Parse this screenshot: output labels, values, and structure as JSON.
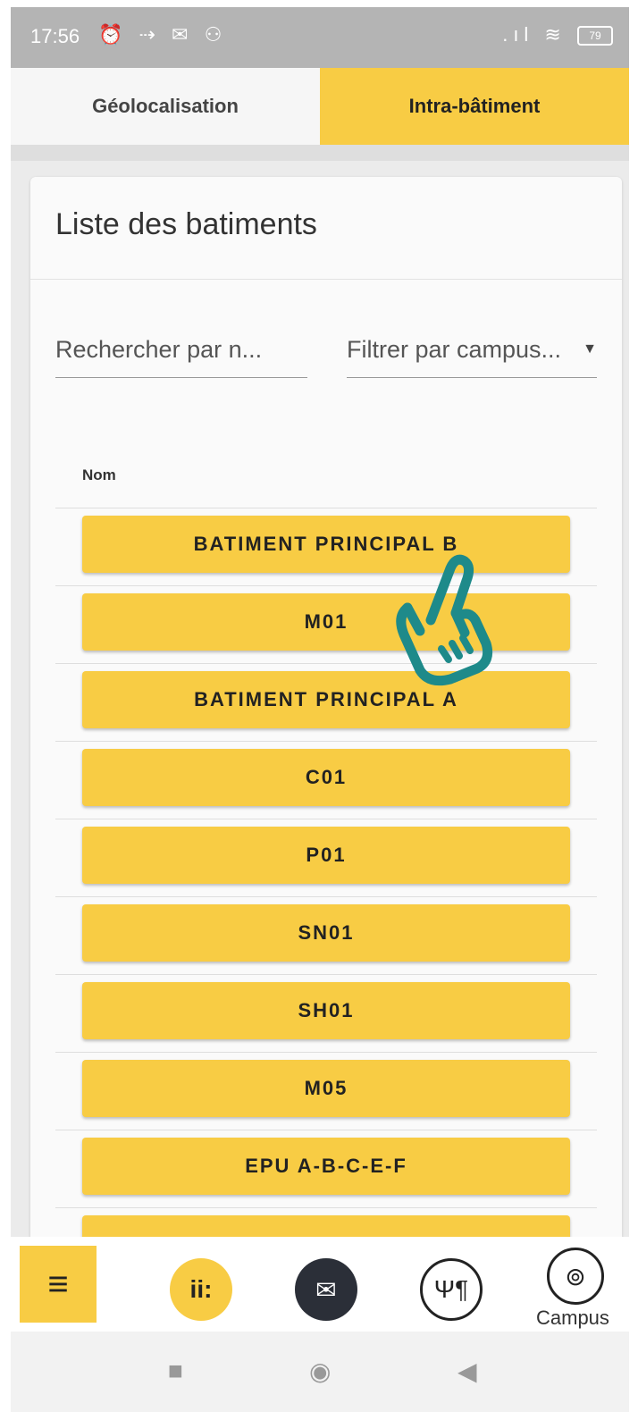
{
  "status_bar": {
    "time": "17:56",
    "left_icons": "⏰ ⇢ ✉ ⚇",
    "right_icons": ".ıl ≋",
    "battery": "79"
  },
  "tabs": [
    {
      "label": "Géolocalisation",
      "active": false
    },
    {
      "label": "Intra-bâtiment",
      "active": true
    }
  ],
  "card": {
    "title": "Liste des batiments",
    "search_placeholder": "Rechercher par n...",
    "filter_placeholder": "Filtrer par campus...",
    "column_header": "Nom",
    "buildings": [
      "BATIMENT PRINCIPAL B",
      "M01",
      "BATIMENT PRINCIPAL A",
      "C01",
      "P01",
      "SN01",
      "SH01",
      "M05",
      "EPU A-B-C-E-F",
      ""
    ]
  },
  "bottom_nav": {
    "menu_icon": "≡",
    "stats_icon": "ii:",
    "mail_icon": "✉",
    "food_icon": "Ψ¶",
    "campus_icon": "⊚",
    "campus_label": "Campus"
  },
  "android_nav": {
    "recent": "■",
    "home": "◉",
    "back": "◀"
  },
  "colors": {
    "accent": "#f8cc44",
    "hand_pointer": "#1e8a8a",
    "statusbar": "#b4b4b4"
  }
}
